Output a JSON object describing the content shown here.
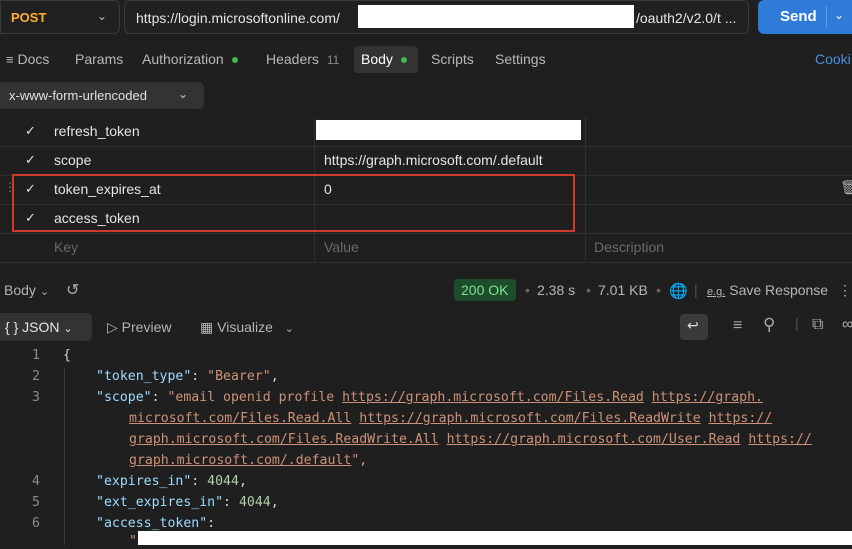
{
  "request": {
    "method": "POST",
    "url_start": "https://login.microsoftonline.com/",
    "url_end": "/oauth2/v2.0/t ...",
    "send_label": "Send"
  },
  "tabs": {
    "docs": "Docs",
    "params": "Params",
    "authorization": "Authorization",
    "headers": "Headers",
    "headers_count": "11",
    "body": "Body",
    "scripts": "Scripts",
    "settings": "Settings",
    "cookies": "Cooki"
  },
  "body_type": "x-www-form-urlencoded",
  "form_rows": [
    {
      "key": "refresh_token",
      "value": ""
    },
    {
      "key": "scope",
      "value": "https://graph.microsoft.com/.default"
    },
    {
      "key": "token_expires_at",
      "value": "0"
    },
    {
      "key": "access_token",
      "value": ""
    }
  ],
  "placeholders": {
    "key": "Key",
    "value": "Value",
    "description": "Description"
  },
  "response": {
    "body_label": "Body",
    "status": "200 OK",
    "time": "2.38 s",
    "size": "7.01 KB",
    "save_label": "Save Response",
    "format": "JSON",
    "preview": "Preview",
    "visualize": "Visualize"
  },
  "code": {
    "line_numbers": [
      "1",
      "2",
      "3",
      "4",
      "5",
      "6"
    ],
    "brace": "{",
    "token_type_key": "\"token_type\"",
    "token_type_val": "\"Bearer\"",
    "scope_key": "\"scope\"",
    "scope_part1": "\"email openid profile ",
    "scope_link1": "https://graph.microsoft.com/Files.Read",
    "scope_link2a": "https://graph.",
    "scope_link2b": "microsoft.com/Files.Read.All",
    "scope_link3": "https://graph.microsoft.com/Files.ReadWrite",
    "scope_link4a": "https://",
    "scope_link4b": "graph.microsoft.com/Files.ReadWrite.All",
    "scope_link5": "https://graph.microsoft.com/User.Read",
    "scope_link6a": "https://",
    "scope_link6b": "graph.microsoft.com/.default",
    "scope_end": "\",",
    "expires_in_key": "\"expires_in\"",
    "expires_in_val": "4044",
    "ext_expires_in_key": "\"ext_expires_in\"",
    "ext_expires_in_val": "4044",
    "access_token_key": "\"access_token\"",
    "access_token_open": "\""
  }
}
